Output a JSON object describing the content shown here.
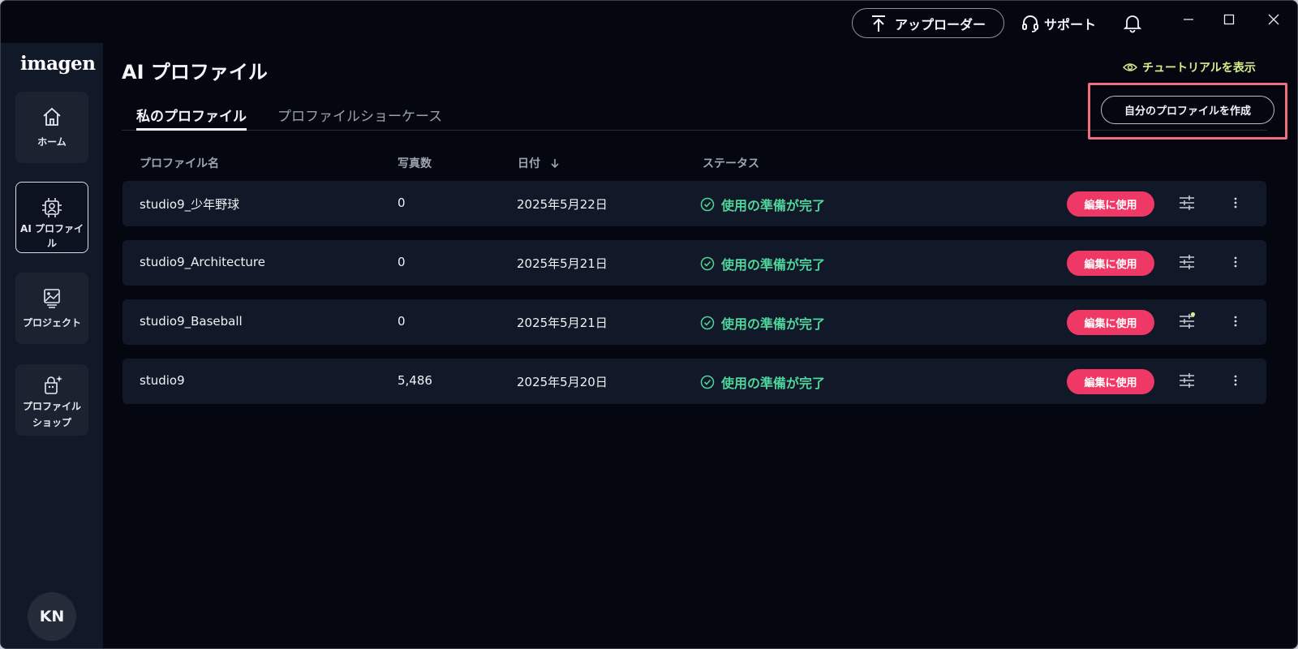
{
  "topbar": {
    "uploader_label": "アップローダー",
    "support_label": "サポート"
  },
  "sidebar": {
    "logo": "imagen",
    "items": [
      {
        "label": "ホーム",
        "icon": "home-icon"
      },
      {
        "label": "AI プロファイル",
        "icon": "ai-profile-icon"
      },
      {
        "label": "プロジェクト",
        "icon": "project-icon"
      },
      {
        "label": "プロファイルショップ",
        "icon": "profile-shop-icon"
      }
    ],
    "avatar_initials": "KN"
  },
  "main": {
    "title": "AI プロファイル",
    "tutorial_label": "チュートリアルを表示",
    "tabs": [
      {
        "label": "私のプロファイル",
        "active": true
      },
      {
        "label": "プロファイルショーケース",
        "active": false
      }
    ],
    "create_button": "自分のプロファイルを作成",
    "columns": {
      "name": "プロファイル名",
      "photos": "写真数",
      "date": "日付",
      "status": "ステータス"
    },
    "rows": [
      {
        "name": "studio9_少年野球",
        "photos": "0",
        "date": "2025年5月22日",
        "status": "使用の準備が完了",
        "action": "編集に使用"
      },
      {
        "name": "studio9_Architecture",
        "photos": "0",
        "date": "2025年5月21日",
        "status": "使用の準備が完了",
        "action": "編集に使用"
      },
      {
        "name": "studio9_Baseball",
        "photos": "0",
        "date": "2025年5月21日",
        "status": "使用の準備が完了",
        "action": "編集に使用"
      },
      {
        "name": "studio9",
        "photos": "5,486",
        "date": "2025年5月20日",
        "status": "使用の準備が完了",
        "action": "編集に使用"
      }
    ]
  },
  "colors": {
    "background": "#04070f",
    "sidebar": "#111827",
    "accent_pink": "#f03866",
    "status_green": "#4ed59b",
    "tutorial_lime": "#d8ee8b",
    "highlight": "#ee6f82"
  }
}
